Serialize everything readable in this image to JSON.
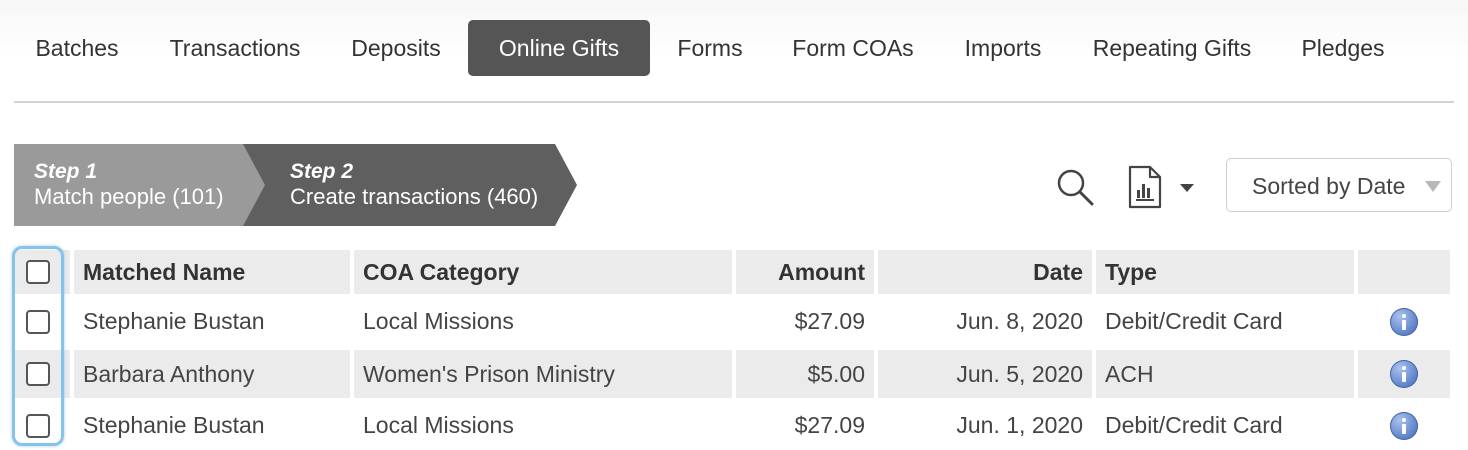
{
  "nav": {
    "tabs": [
      {
        "label": "Batches"
      },
      {
        "label": "Transactions"
      },
      {
        "label": "Deposits"
      },
      {
        "label": "Online Gifts",
        "active": true
      },
      {
        "label": "Forms"
      },
      {
        "label": "Form COAs"
      },
      {
        "label": "Imports"
      },
      {
        "label": "Repeating Gifts"
      },
      {
        "label": "Pledges"
      }
    ]
  },
  "steps": [
    {
      "title": "Step 1",
      "subtitle": "Match people (101)"
    },
    {
      "title": "Step 2",
      "subtitle": "Create transactions (460)"
    }
  ],
  "toolbar": {
    "search_icon": "search-icon",
    "report_icon": "report-icon",
    "sort": {
      "selected": "Sorted by Date"
    }
  },
  "table": {
    "columns": {
      "name": "Matched Name",
      "coa": "COA Category",
      "amount": "Amount",
      "date": "Date",
      "type": "Type"
    },
    "rows": [
      {
        "name": "Stephanie Bustan",
        "coa": "Local Missions",
        "amount": "$27.09",
        "date": "Jun. 8, 2020",
        "type": "Debit/Credit Card"
      },
      {
        "name": "Barbara Anthony",
        "coa": "Women's Prison Ministry",
        "amount": "$5.00",
        "date": "Jun. 5, 2020",
        "type": "ACH"
      },
      {
        "name": "Stephanie Bustan",
        "coa": "Local Missions",
        "amount": "$27.09",
        "date": "Jun. 1, 2020",
        "type": "Debit/Credit Card"
      }
    ]
  },
  "colors": {
    "active_tab": "#555555",
    "step1": "#9a9a9a",
    "step2": "#5f5f5f",
    "row_stripe": "#ebebeb",
    "focus_ring": "#85c3ec",
    "info_icon": "#5b80c9"
  }
}
